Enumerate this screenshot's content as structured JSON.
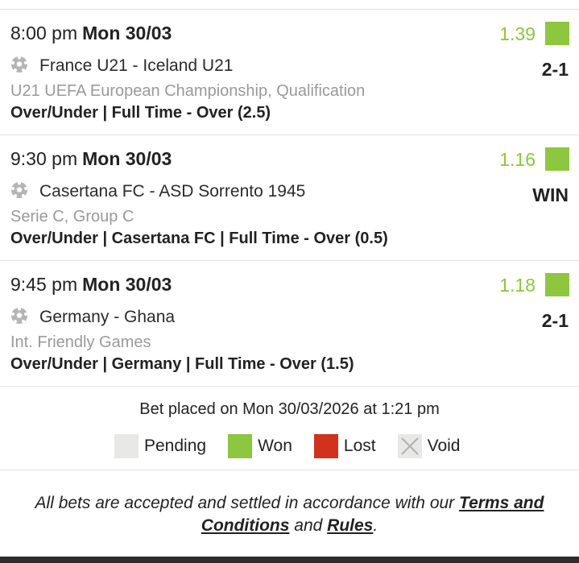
{
  "bets": [
    {
      "time": "8:00 pm",
      "date": "Mon 30/03",
      "match": "France U21 - Iceland U21",
      "competition": "U21 UEFA European Championship, Qualification",
      "market": "Over/Under | Full Time - Over (2.5)",
      "odds": "1.39",
      "result": "2-1",
      "status": "won"
    },
    {
      "time": "9:30 pm",
      "date": "Mon 30/03",
      "match": "Casertana FC - ASD Sorrento 1945",
      "competition": "Serie C, Group C",
      "market": "Over/Under | Casertana FC | Full Time - Over (0.5)",
      "odds": "1.16",
      "result": "WIN",
      "status": "won"
    },
    {
      "time": "9:45 pm",
      "date": "Mon 30/03",
      "match": "Germany - Ghana",
      "competition": "Int. Friendly Games",
      "market": "Over/Under | Germany | Full Time - Over (1.5)",
      "odds": "1.18",
      "result": "2-1",
      "status": "won"
    }
  ],
  "placed_text": "Bet placed on Mon 30/03/2026 at 1:21 pm",
  "legend": {
    "pending": "Pending",
    "won": "Won",
    "lost": "Lost",
    "void": "Void"
  },
  "colors": {
    "won": "#8dc63f",
    "lost": "#d0321e",
    "pending": "#e8e8e6",
    "odds": "#8cc63f"
  },
  "terms": {
    "before": "All bets are accepted and settled in accordance with our",
    "terms_link": "Terms and Conditions",
    "and": "and",
    "rules_link": "Rules",
    "end": "."
  }
}
